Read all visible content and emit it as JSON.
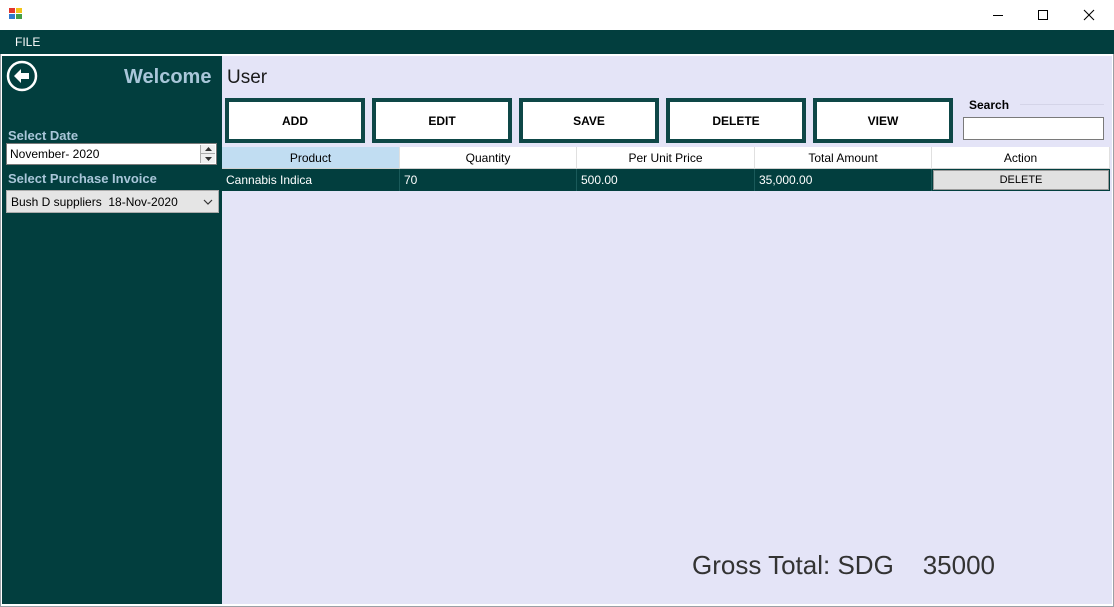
{
  "window": {
    "title": ""
  },
  "menu": {
    "file": "FILE"
  },
  "sidebar": {
    "welcome": "Welcome",
    "select_date_label": "Select Date",
    "date_value": "November- 2020",
    "select_invoice_label": "Select Purchase Invoice",
    "invoice_value": "Bush D suppliers  18-Nov-2020"
  },
  "main": {
    "title": "User",
    "toolbar": {
      "add": "ADD",
      "edit": "EDIT",
      "save": "SAVE",
      "delete": "DELETE",
      "view": "VIEW"
    },
    "search": {
      "label": "Search",
      "value": "",
      "placeholder": ""
    },
    "table": {
      "columns": [
        "Product",
        "Quantity",
        "Per Unit Price",
        "Total Amount",
        "Action"
      ],
      "rows": [
        {
          "product": "Cannabis Indica",
          "quantity": "70",
          "unit_price": "500.00",
          "total": "35,000.00",
          "action": "DELETE"
        }
      ]
    },
    "gross_total": {
      "label": "Gross Total: SDG",
      "value": "35000"
    }
  },
  "colors": {
    "sidebar_bg": "#023e3e",
    "main_bg": "#e4e4f7",
    "accent_text": "#a9c6d9",
    "button_border": "#0e4747",
    "header_selected": "#c1ddf2"
  },
  "icons": {
    "back": "back-arrow-circle-icon",
    "minimize": "minimize-icon",
    "maximize": "maximize-icon",
    "close": "close-icon",
    "dropdown": "chevron-down-icon"
  }
}
